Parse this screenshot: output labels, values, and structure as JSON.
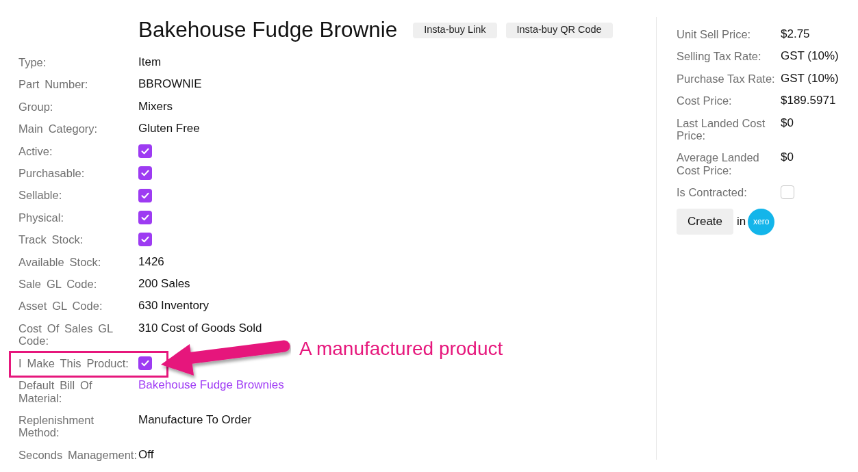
{
  "title": "Bakehouse Fudge Brownie",
  "header_buttons": [
    {
      "label": "Insta-buy Link"
    },
    {
      "label": "Insta-buy QR Code"
    }
  ],
  "details": [
    {
      "label": "Type:",
      "kind": "text",
      "value": "Item",
      "highlighted": false
    },
    {
      "label": "Part Number:",
      "kind": "text",
      "value": "BBROWNIE",
      "highlighted": false
    },
    {
      "label": "Group:",
      "kind": "text",
      "value": "Mixers",
      "highlighted": false
    },
    {
      "label": "Main Category:",
      "kind": "text",
      "value": "Gluten Free",
      "highlighted": false
    },
    {
      "label": "Active:",
      "kind": "checkbox",
      "checked": true,
      "highlighted": false
    },
    {
      "label": "Purchasable:",
      "kind": "checkbox",
      "checked": true,
      "highlighted": false
    },
    {
      "label": "Sellable:",
      "kind": "checkbox",
      "checked": true,
      "highlighted": false
    },
    {
      "label": "Physical:",
      "kind": "checkbox",
      "checked": true,
      "highlighted": false
    },
    {
      "label": "Track Stock:",
      "kind": "checkbox",
      "checked": true,
      "highlighted": false
    },
    {
      "label": "Available Stock:",
      "kind": "text",
      "value": "1426",
      "highlighted": false
    },
    {
      "label": "Sale GL Code:",
      "kind": "text",
      "value": "200 Sales",
      "highlighted": false
    },
    {
      "label": "Asset GL Code:",
      "kind": "text",
      "value": "630 Inventory",
      "highlighted": false
    },
    {
      "label": "Cost Of Sales GL Code:",
      "kind": "text",
      "value": "310 Cost of Goods Sold",
      "highlighted": false
    },
    {
      "label": "I Make This Product:",
      "kind": "checkbox",
      "checked": true,
      "highlighted": true
    },
    {
      "label": "Default Bill Of Material:",
      "kind": "link",
      "value": "Bakehouse Fudge Brownies",
      "highlighted": false
    },
    {
      "label": "Replenishment Method:",
      "kind": "text",
      "value": "Manufacture To Order",
      "highlighted": false
    },
    {
      "label": "Seconds Management:",
      "kind": "text",
      "value": "Off",
      "highlighted": false
    }
  ],
  "annotation": {
    "text": "A manufactured product"
  },
  "pricing": [
    {
      "label": "Unit Sell Price:",
      "kind": "text",
      "value": "$2.75"
    },
    {
      "label": "Selling Tax Rate:",
      "kind": "text",
      "value": "GST (10%)"
    },
    {
      "label": "Purchase Tax Rate:",
      "kind": "text",
      "value": "GST (10%)"
    },
    {
      "label": "Cost Price:",
      "kind": "text",
      "value": "$189.5971"
    },
    {
      "label": "Last Landed Cost Price:",
      "kind": "text",
      "value": "$0"
    },
    {
      "label": "Average Landed Cost Price:",
      "kind": "text",
      "value": "$0"
    },
    {
      "label": "Is Contracted:",
      "kind": "checkbox",
      "checked": false
    }
  ],
  "xero": {
    "button": "Create",
    "connector": "in",
    "logo_text": "xero"
  }
}
